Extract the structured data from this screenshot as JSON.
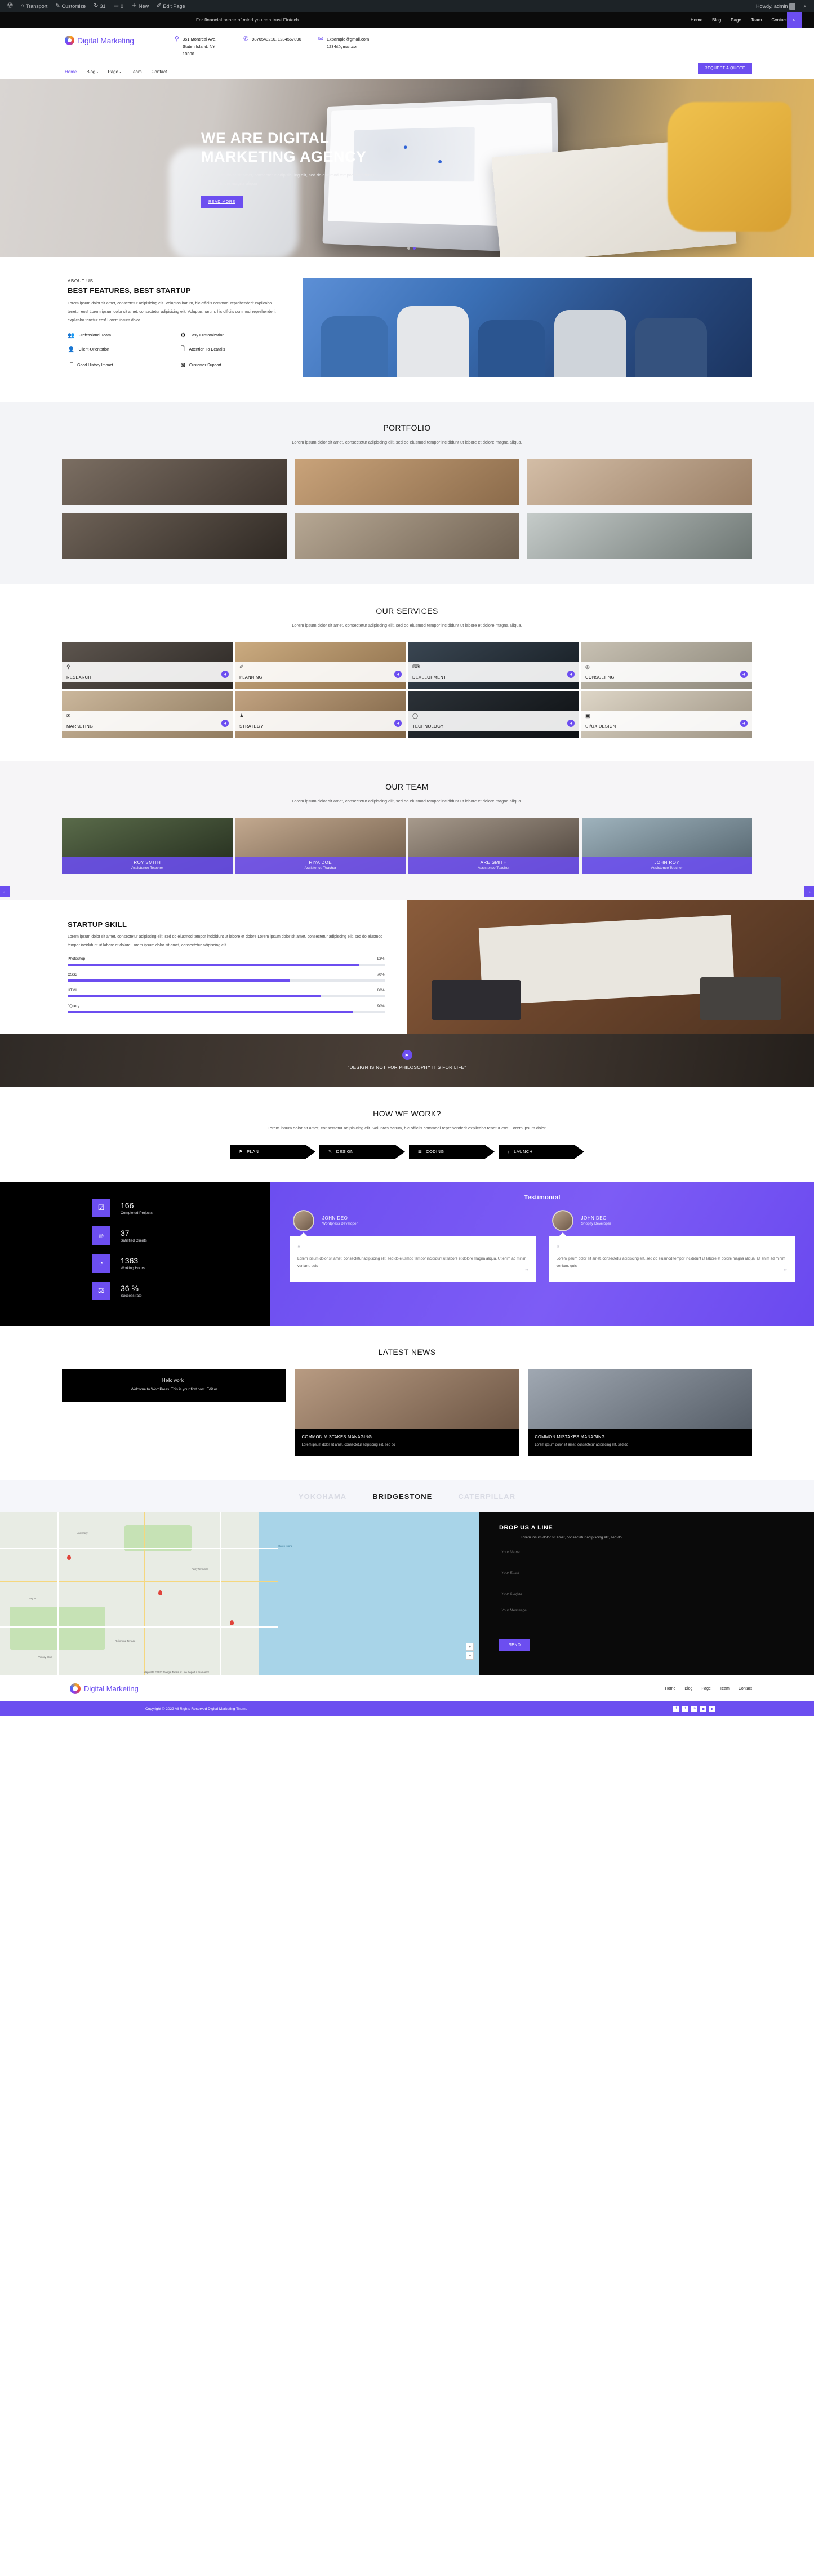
{
  "admin_bar": {
    "items": [
      {
        "icon": "wordpress-icon",
        "label": ""
      },
      {
        "icon": "dashboard-icon",
        "label": "Transport"
      },
      {
        "icon": "brush-icon",
        "label": "Customize"
      },
      {
        "icon": "updates-icon",
        "label": "31"
      },
      {
        "icon": "comment-icon",
        "label": "0"
      },
      {
        "icon": "plus-icon",
        "label": "New"
      },
      {
        "icon": "pencil-icon",
        "label": "Edit Page"
      }
    ],
    "howdy": "Howdy, admin",
    "search_icon": "search-icon"
  },
  "topbar": {
    "tagline": "For financial peace of mind you can trust Fintech",
    "nav": [
      "Home",
      "Blog",
      "Page",
      "Team",
      "Contact"
    ],
    "search_icon": "search-icon"
  },
  "header": {
    "logo_text": "Digital Marketing",
    "address": "351 Montreal Ave, Staten Island, NY 10306",
    "phone": "9876543210, 1234567890",
    "email_line1": "Expample@gmail.com",
    "email_line2": "1234@gmail.com",
    "nav": [
      {
        "label": "Home",
        "active": true,
        "caret": false
      },
      {
        "label": "Blog",
        "active": false,
        "caret": true
      },
      {
        "label": "Page",
        "active": false,
        "caret": true
      },
      {
        "label": "Team",
        "active": false,
        "caret": false
      },
      {
        "label": "Contact",
        "active": false,
        "caret": false
      }
    ],
    "quote_button": "REQUEST A QUOTE"
  },
  "hero": {
    "title_line1": "WE ARE DIGITAL",
    "title_line2": "MARKETING AGENCY",
    "description": "Lorem ipsum dolor sit amet, consectetur adipisic- ing elit, sed do eiusmod tempor incididunt ut labore et dolore magna aliqua",
    "button": "READ MORE",
    "slide_dots": 2,
    "active_dot": 1
  },
  "about": {
    "kicker": "ABOUT US",
    "title": "BEST FEATURES, BEST STARTUP",
    "body": "Lorem ipsum dolor sit amet, consectetur adipisicing elit. Voluptas harum, hic officiis commodi reprehenderit explicabo tenetur eos! Lorem ipsum dolor sit amet, consectetur adipisicing elit. Voluptas harum, hic officiis commodi reprehenderit explicabo tenetur eos! Lorem ipsum dolor.",
    "features": [
      {
        "icon": "team-icon",
        "glyph": "⛬",
        "label": "Professional Team"
      },
      {
        "icon": "gears-icon",
        "glyph": "⚙",
        "label": "Easy Customization"
      },
      {
        "icon": "person-icon",
        "glyph": "●",
        "label": "Client-Orientation"
      },
      {
        "icon": "document-icon",
        "glyph": "❐",
        "label": "Attention To Deatails"
      },
      {
        "icon": "folder-icon",
        "glyph": "▰",
        "label": "Good History Impact"
      },
      {
        "icon": "support-icon",
        "glyph": "⌧",
        "label": "Customer Support"
      }
    ]
  },
  "portfolio": {
    "title": "PORTFOLIO",
    "subtitle": "Lorem ipsum dolor sit amet, consectetur adipiscing elit, sed do eiusmod tempor incididunt ut labore et dolore magna aliqua.",
    "items": [
      {
        "alt": "two-men-meeting",
        "c1": "#7b6e62",
        "c2": "#3f3630"
      },
      {
        "alt": "whiteboard-session",
        "c1": "#c9a37a",
        "c2": "#8a6a4a"
      },
      {
        "alt": "woman-at-desk",
        "c1": "#d3bda6",
        "c2": "#9a7f66"
      },
      {
        "alt": "team-sticky-notes",
        "c1": "#6e6257",
        "c2": "#2e2823"
      },
      {
        "alt": "laptop-tablet-desk",
        "c1": "#b7a894",
        "c2": "#6f6152"
      },
      {
        "alt": "dual-monitor-setup",
        "c1": "#c5cbc9",
        "c2": "#6d7673"
      }
    ]
  },
  "services": {
    "title": "OUR SERVICES",
    "subtitle": "Lorem ipsum dolor sit amet, consectetur adipiscing elit, sed do eiusmod tempor incididunt ut labore et dolore magna aliqua.",
    "items": [
      {
        "label": "RESEARCH",
        "icon": "magnify-chart-icon",
        "glyph": "⚲",
        "c1": "#5d554e",
        "c2": "#2b2724"
      },
      {
        "label": "PLANNING",
        "icon": "plan-doc-icon",
        "glyph": "✐",
        "c1": "#cbab80",
        "c2": "#8d6f4b"
      },
      {
        "label": "DEVELOPMENT",
        "icon": "code-device-icon",
        "glyph": "⌨",
        "c1": "#3a4652",
        "c2": "#151c22"
      },
      {
        "label": "CONSULTING",
        "icon": "target-icon",
        "glyph": "◎",
        "c1": "#c8c1b3",
        "c2": "#8b8679"
      },
      {
        "label": "MARKETING",
        "icon": "megaphone-icon",
        "glyph": "✉",
        "c1": "#cbb79c",
        "c2": "#8f7a5e"
      },
      {
        "label": "STRATEGY",
        "icon": "chess-icon",
        "glyph": "♟",
        "c1": "#c2a381",
        "c2": "#7d6345"
      },
      {
        "label": "TECHNOLOGY",
        "icon": "mouse-icon",
        "glyph": "◯",
        "c1": "#2c3238",
        "c2": "#0d1013"
      },
      {
        "label": "UI/UX DESIGN",
        "icon": "monitor-icon",
        "glyph": "▣",
        "c1": "#ded6c7",
        "c2": "#9d9383"
      }
    ]
  },
  "team": {
    "title": "OUR TEAM",
    "subtitle": "Lorem ipsum dolor sit amet, consectetur adipiscing elit, sed do eiusmod tempor incididunt ut labore et dolore magna aliqua.",
    "prev_icon": "arrow-left-icon",
    "next_icon": "arrow-right-icon",
    "members": [
      {
        "name": "ROY SMITH",
        "role": "Assistence Teacher",
        "c1": "#5a6b4a",
        "c2": "#222b1c"
      },
      {
        "name": "RIYA DOE",
        "role": "Assistence Teacher",
        "c1": "#c3a98f",
        "c2": "#6d5a48"
      },
      {
        "name": "ARE SMITH",
        "role": "Assistence Teacher",
        "c1": "#a79a8c",
        "c2": "#4a4038"
      },
      {
        "name": "JOHN ROY",
        "role": "Assistence Teacher",
        "c1": "#9fb3bd",
        "c2": "#4f5f69"
      }
    ]
  },
  "skill": {
    "title": "STARTUP SKILL",
    "body": "Lorem ipsum dolor sit amet, consectetur adipiscing elit, sed do eiusmod tempor incididunt ut labore et dolore.Lorem ipsum dolor sit amet, consectetur adipiscing elit, sed do eiusmod tempor incididunt ut labore et dolore.Lorem ipsum dolor sit amet, consectetur adipiscing elit.",
    "bars": [
      {
        "label": "Photoshop",
        "value": "92%",
        "pct": 92
      },
      {
        "label": "CSS3",
        "value": "70%",
        "pct": 70
      },
      {
        "label": "HTML",
        "value": "80%",
        "pct": 80
      },
      {
        "label": "JQuery",
        "value": "90%",
        "pct": 90
      }
    ]
  },
  "video_cta": {
    "play_icon": "play-icon",
    "quote": "\"DESIGN IS NOT FOR PHILOSOPHY IT'S FOR LIFE\""
  },
  "how_we_work": {
    "title": "HOW WE WORK?",
    "subtitle": "Lorem ipsum dolor sit amet, consectetur adipisicing elit. Voluptas harum, hic officiis commodi reprehenderit explicabo tenetur eos! Lorem ipsum dolor.",
    "steps": [
      {
        "label": "PLAN",
        "icon": "lighthouse-icon",
        "glyph": "⚑"
      },
      {
        "label": "DESIGN",
        "icon": "ruler-icon",
        "glyph": "✎"
      },
      {
        "label": "CODING",
        "icon": "browser-icon",
        "glyph": "☰"
      },
      {
        "label": "LAUNCH",
        "icon": "rocket-icon",
        "glyph": "↑"
      }
    ]
  },
  "counters": [
    {
      "value": "166",
      "label": "Completed Projects",
      "icon": "document-check-icon",
      "glyph": "☑"
    },
    {
      "value": "37",
      "label": "Satisfied Clients",
      "icon": "user-plus-icon",
      "glyph": "☺"
    },
    {
      "value": "1363",
      "label": "Working Hours",
      "icon": "clock-icon",
      "glyph": "◔"
    },
    {
      "value": "36 %",
      "label": "Success rate",
      "icon": "trophy-icon",
      "glyph": "⚖"
    }
  ],
  "testimonial": {
    "title": "Testimonial",
    "items": [
      {
        "name": "JOHN DEO",
        "role": "Wordpress Developer",
        "quote": "Lorem ipsum dolor sit amet, consectetur adipiscing elit, sed do eiusmod tempor incididunt ut labore et dolore magna aliqua. Ut enim ad minim veniam, quis",
        "open_quote": "“",
        "close_quote": "”"
      },
      {
        "name": "JOHN DEO",
        "role": "Shopify Developer",
        "quote": "Lorem ipsum dolor sit amet, consectetur adipiscing elit, sed do eiusmod tempor incididunt ut labore et dolore magna aliqua. Ut enim ad minim veniam, quis",
        "open_quote": "“",
        "close_quote": "”"
      }
    ]
  },
  "news": {
    "title": "LATEST NEWS",
    "first_post": {
      "title": "Hello world!",
      "excerpt": "Welcome to WordPress. This is your first post. Edit or"
    },
    "posts": [
      {
        "title": "COMMON MISTAKES MANAGING",
        "excerpt": "Lorem ipsum dolor sit amet, consectetur adipiscing elit, sed do",
        "c1": "#b89b82",
        "c2": "#6c5544"
      },
      {
        "title": "COMMON MISTAKES MANAGING",
        "excerpt": "Lorem ipsum dolor sit amet, consectetur adipiscing elit, sed do",
        "c1": "#a0a8b2",
        "c2": "#565e68"
      }
    ]
  },
  "brands": [
    "YOKOHAMA",
    "BRIDGESTONE",
    "CATERPILLAR"
  ],
  "contact_form": {
    "title": "DROP US A LINE",
    "subtitle": "Lorem ipsum dolor sit amet, consectetur adipiscing elit, sed do",
    "fields": [
      {
        "name": "your-name",
        "placeholder": "Your Name",
        "value": ""
      },
      {
        "name": "your-email",
        "placeholder": "Your Email",
        "value": ""
      },
      {
        "name": "your-subject",
        "placeholder": "Your Subject",
        "value": ""
      },
      {
        "name": "your-message",
        "placeholder": "Your Messsage",
        "value": ""
      }
    ],
    "submit": "SEND"
  },
  "map": {
    "labels": [
      "University",
      "Ferry Terminal",
      "Bay St",
      "Richmond Terrace",
      "Staten Island",
      "Victory Blvd"
    ],
    "zoom_in": "+",
    "zoom_out": "−",
    "attribution": "Map data ©2022 Google  Terms of Use  Report a map error"
  },
  "footer": {
    "logo_text": "Digital Marketing",
    "nav": [
      "Home",
      "Blog",
      "Page",
      "Team",
      "Contact"
    ],
    "copyright": "Copyright © 2022 All Rights Reserved Digital Marketing Theme.",
    "socials": [
      {
        "icon": "facebook-icon",
        "glyph": "f"
      },
      {
        "icon": "twitter-icon",
        "glyph": "t"
      },
      {
        "icon": "linkedin-icon",
        "glyph": "in"
      },
      {
        "icon": "instagram-icon",
        "glyph": "▣"
      },
      {
        "icon": "youtube-icon",
        "glyph": "▶"
      }
    ]
  },
  "colors": {
    "accent": "#6c4ef0",
    "dark": "#000000",
    "light_gray": "#f3f4f7"
  }
}
